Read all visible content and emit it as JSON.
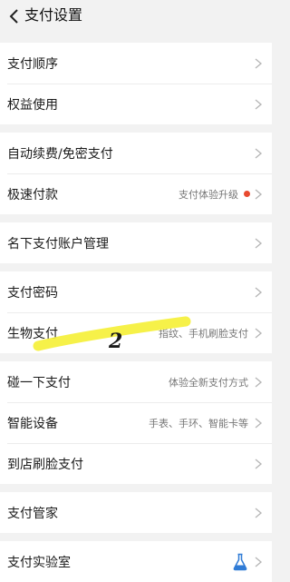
{
  "header": {
    "title": "支付设置"
  },
  "groups": [
    {
      "items": [
        {
          "label": "支付顺序"
        },
        {
          "label": "权益使用"
        }
      ]
    },
    {
      "items": [
        {
          "label": "自动续费/免密支付"
        },
        {
          "label": "极速付款",
          "sub": "支付体验升级"
        }
      ]
    },
    {
      "items": [
        {
          "label": "名下支付账户管理"
        }
      ]
    },
    {
      "items": [
        {
          "label": "支付密码"
        },
        {
          "label": "生物支付",
          "sub": "指纹、手机刷脸支付"
        }
      ]
    },
    {
      "items": [
        {
          "label": "碰一下支付",
          "sub": "体验全新支付方式"
        },
        {
          "label": "智能设备",
          "sub": "手表、手环、智能卡等"
        },
        {
          "label": "到店刷脸支付"
        }
      ]
    },
    {
      "items": [
        {
          "label": "支付管家"
        }
      ]
    },
    {
      "items": [
        {
          "label": "支付实验室"
        }
      ]
    }
  ],
  "annotation": {
    "number": "2",
    "highlight_color": "#f5f03a"
  },
  "colors": {
    "badge": "#e84a2f",
    "lab_icon": "#2f7bd6"
  }
}
